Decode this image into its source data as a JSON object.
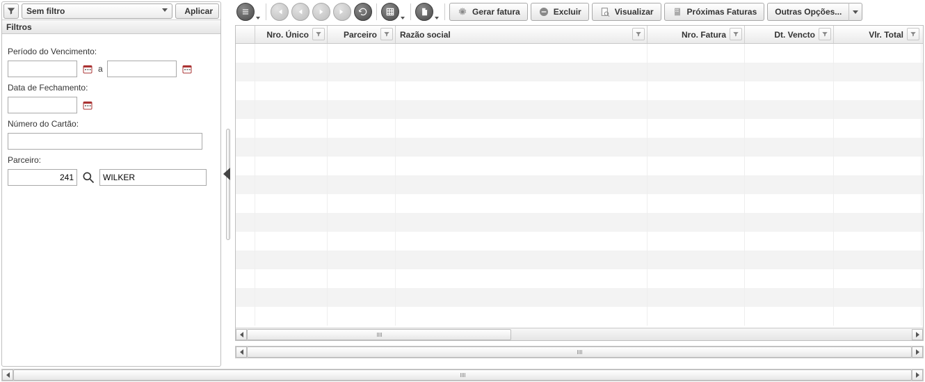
{
  "filter_bar": {
    "select_label": "Sem filtro",
    "apply_label": "Aplicar"
  },
  "filters_section": {
    "title": "Filtros",
    "periodo_label": "Período do Vencimento:",
    "periodo_sep": "a",
    "data_fech_label": "Data de Fechamento:",
    "numero_cartao_label": "Número do Cartão:",
    "parceiro_label": "Parceiro:",
    "parceiro_code": "241",
    "parceiro_name": "WILKER"
  },
  "toolbar": {
    "gerar_fatura": "Gerar fatura",
    "excluir": "Excluir",
    "visualizar": "Visualizar",
    "proximas_faturas": "Próximas Faturas",
    "outras_opcoes": "Outras Opções..."
  },
  "grid": {
    "cols": {
      "nro_unico": "Nro. Único",
      "parceiro": "Parceiro",
      "razao_social": "Razão social",
      "nro_fatura": "Nro. Fatura",
      "dt_vencto": "Dt. Vencto",
      "vlr_total": "Vlr. Total"
    }
  }
}
